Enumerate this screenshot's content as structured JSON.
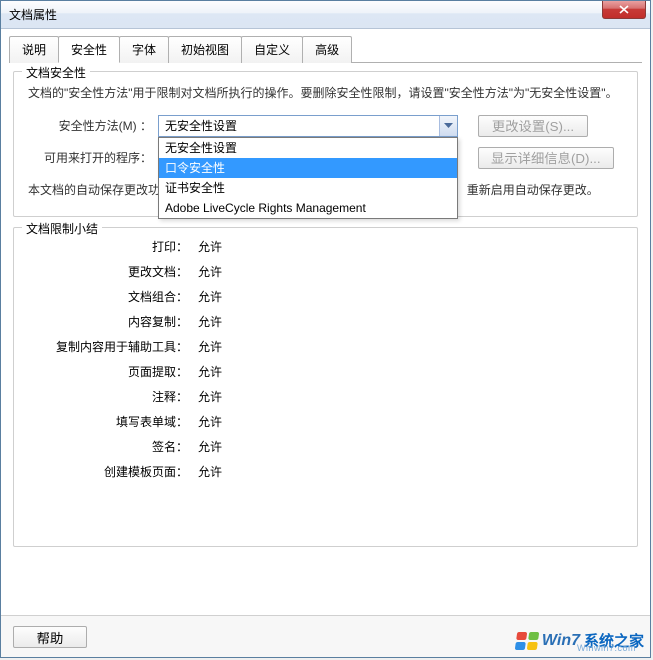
{
  "window": {
    "title": "文档属性"
  },
  "tabs": {
    "items": [
      {
        "label": "说明"
      },
      {
        "label": "安全性"
      },
      {
        "label": "字体"
      },
      {
        "label": "初始视图"
      },
      {
        "label": "自定义"
      },
      {
        "label": "高级"
      }
    ],
    "active_index": 1
  },
  "security": {
    "fieldset_title": "文档安全性",
    "description": "文档的\"安全性方法\"用于限制对文档所执行的操作。要删除安全性限制，请设置\"安全性方法\"为\"无安全性设置\"。",
    "method_label": "安全性方法(M) ：",
    "method_value": "无安全性设置",
    "method_options": [
      "无安全性设置",
      "口令安全性",
      "证书安全性",
      "Adobe LiveCycle Rights Management"
    ],
    "method_selected_index": 1,
    "change_settings_btn": "更改设置(S)...",
    "open_with_label": "可用来打开的程序：",
    "show_details_btn": "显示详细信息(D)...",
    "autosave_note_prefix": "本文档的自动保存更改功",
    "autosave_note_suffix": "重新启用自动保存更改。"
  },
  "restrictions": {
    "fieldset_title": "文档限制小结",
    "allowed": "允许",
    "items": [
      {
        "label": "打印："
      },
      {
        "label": "更改文档："
      },
      {
        "label": "文档组合："
      },
      {
        "label": "内容复制："
      },
      {
        "label": "复制内容用于辅助工具："
      },
      {
        "label": "页面提取："
      },
      {
        "label": "注释："
      },
      {
        "label": "填写表单域："
      },
      {
        "label": "签名："
      },
      {
        "label": "创建模板页面："
      }
    ]
  },
  "bottom": {
    "help": "帮助"
  },
  "watermark": {
    "t1": "Win7",
    "t2": "系统之家",
    "sub": "Winwin7.com"
  }
}
